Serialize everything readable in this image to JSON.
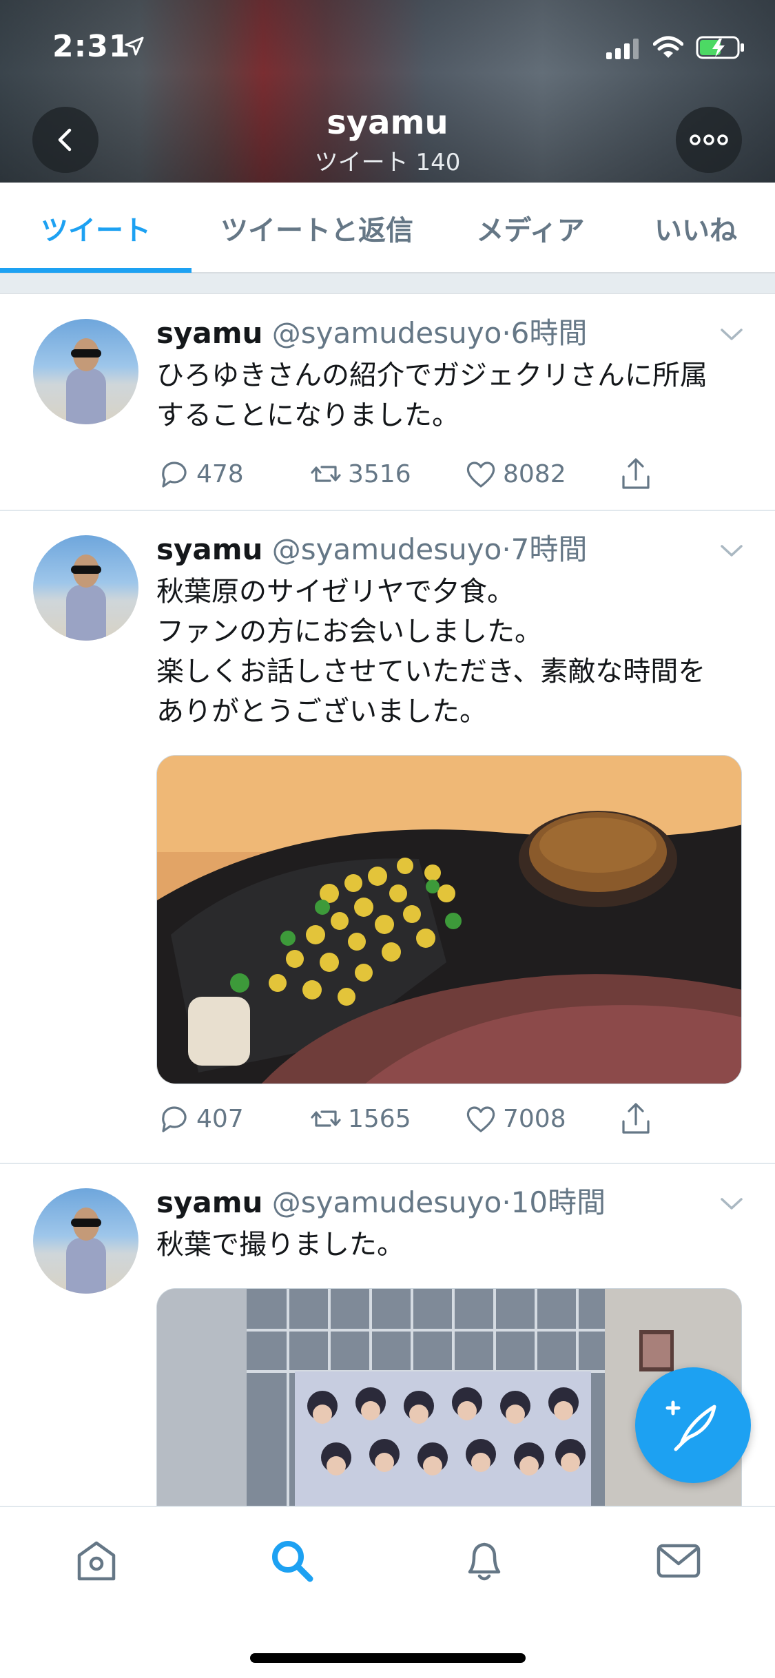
{
  "status_bar": {
    "time": "2:31"
  },
  "profile_nav": {
    "title": "syamu",
    "subtitle": "ツイート 140"
  },
  "tabs": [
    {
      "label": "ツイート",
      "active": true
    },
    {
      "label": "ツイートと返信",
      "active": false
    },
    {
      "label": "メディア",
      "active": false
    },
    {
      "label": "いいね",
      "active": false
    }
  ],
  "tweets": [
    {
      "name": "syamu",
      "handle": "@syamudesuyo",
      "time": "·6時間",
      "text": "ひろゆきさんの紹介でガジェクリさんに所属\nすることになりました。",
      "replies": "478",
      "retweets": "3516",
      "likes": "8082"
    },
    {
      "name": "syamu",
      "handle": "@syamudesuyo",
      "time": "·7時間",
      "text": "秋葉原のサイゼリヤで夕食。\nファンの方にお会いしました。\n楽しくお話しさせていただき、素敵な時間を\nありがとうございました。",
      "replies": "407",
      "retweets": "1565",
      "likes": "7008"
    },
    {
      "name": "syamu",
      "handle": "@syamudesuyo",
      "time": "·10時間",
      "text": "秋葉で撮りました。"
    }
  ],
  "icons": {
    "accent": "#1da1f2",
    "secondary_text": "#657786"
  }
}
